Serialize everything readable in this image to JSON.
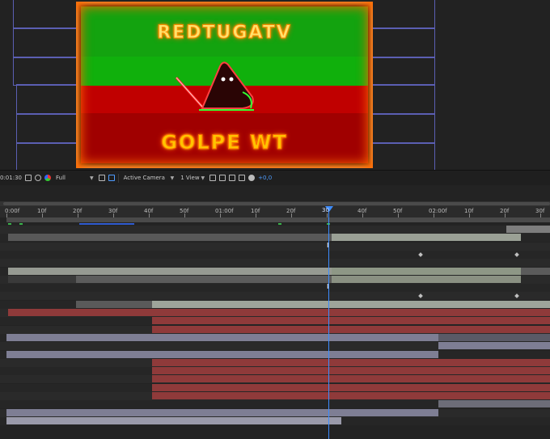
{
  "viewer": {
    "title_text": "REDTUGATV",
    "subtitle_text": "GOLPE WT"
  },
  "toolbar": {
    "timecode": "0:01:30",
    "resolution": "Full",
    "camera": "Active Camera",
    "views": "1 View",
    "offset": "+0,0"
  },
  "timeline": {
    "ruler_labels": [
      "0:00f",
      "10f",
      "20f",
      "30f",
      "40f",
      "50f",
      "01:00f",
      "10f",
      "20f",
      "30f",
      "40f",
      "50f",
      "02:00f",
      "10f",
      "20f",
      "30f"
    ],
    "current_time_label": "30"
  },
  "colors": {
    "flag_green": "#13a30f",
    "flag_red": "#b00000",
    "fire_orange": "#ff6a00",
    "cti_blue": "#3c8cff",
    "layer_gray": "#7e7e94",
    "layer_sage": "#8e9786",
    "layer_red": "#8f3a3a"
  }
}
